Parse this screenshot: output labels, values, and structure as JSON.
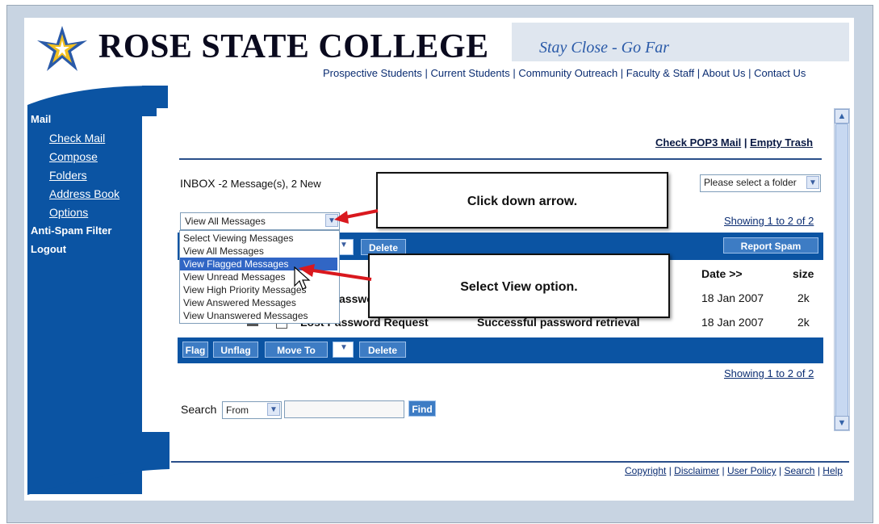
{
  "header": {
    "college_name": "ROSE STATE COLLEGE",
    "tagline": "Stay Close - Go Far",
    "nav": [
      "Prospective Students",
      "Current Students",
      "Community Outreach",
      "Faculty & Staff",
      "About Us",
      "Contact Us"
    ]
  },
  "sidebar": {
    "mail": "Mail",
    "links": [
      "Check Mail",
      "Compose",
      "Folders",
      "Address Book",
      "Options"
    ],
    "anti_spam": "Anti-Spam Filter",
    "logout": "Logout"
  },
  "content": {
    "check_pop3": "Check POP3 Mail",
    "empty_trash": "Empty Trash",
    "inbox_label": "INBOX",
    "inbox_counts": "-2 Message(s), 2 New",
    "folder_select": "Please select a folder",
    "view_select": "View All Messages",
    "showing": "Showing 1 to 2 of 2",
    "report_spam": "Report Spam",
    "delete": "Delete",
    "columns": {
      "date": "Date >>",
      "size": "size"
    },
    "rows": [
      {
        "subject_visible": "asswo",
        "date": "18 Jan 2007",
        "size": "2k"
      },
      {
        "subject": "Lost Password Request",
        "preview": "Successful password retrieval",
        "date": "18 Jan 2007",
        "size": "2k"
      }
    ],
    "bottom_buttons": {
      "flag": "Flag",
      "unflag": "Unflag",
      "move_to": "Move To",
      "delete": "Delete"
    },
    "search_label": "Search",
    "search_field": "From",
    "find": "Find"
  },
  "dropdown_options": [
    "Select Viewing Messages",
    "View All Messages",
    "View Flagged Messages",
    "View Unread Messages",
    "View High Priority Messages",
    "View Answered Messages",
    "View Unanswered Messages"
  ],
  "dropdown_selected_index": 2,
  "callouts": {
    "first": "Click down arrow.",
    "second": "Select View option."
  },
  "footer": [
    "Copyright",
    "Disclaimer",
    "User Policy",
    "Search",
    "Help"
  ],
  "colors": {
    "brand_blue": "#0b54a3",
    "callout_arrow": "#d9181e",
    "highlight": "#3166c5"
  }
}
